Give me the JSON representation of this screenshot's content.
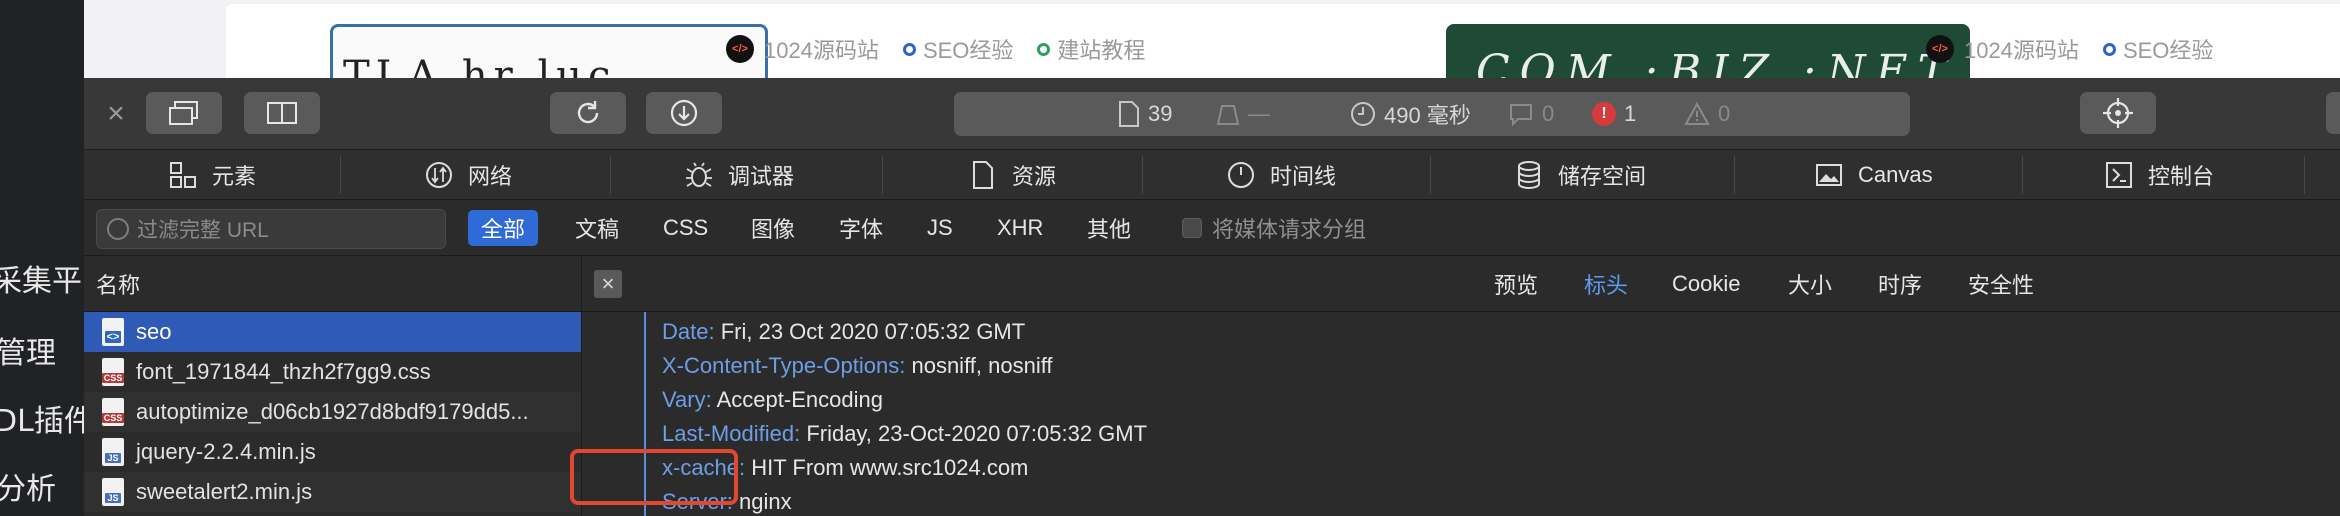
{
  "sidebar": {
    "items": [
      "采集平台",
      "管理",
      "DL插件",
      "分析"
    ]
  },
  "webpage": {
    "cards": [
      {
        "site_name": "1024源码站",
        "logo_text": "</>",
        "tags": [
          "SEO经验",
          "建站教程"
        ]
      },
      {
        "site_name": "1024源码站",
        "logo_text": "</>",
        "tags": [
          "SEO经验"
        ]
      }
    ]
  },
  "toolbar": {
    "close_label": "×",
    "summary": {
      "resources": "39",
      "transferred": "—",
      "load_time": "490 毫秒",
      "logs": "0",
      "errors": "1",
      "warnings": "0"
    }
  },
  "tabs": [
    {
      "label": "元素",
      "icon": "elements-icon"
    },
    {
      "label": "网络",
      "icon": "network-icon"
    },
    {
      "label": "调试器",
      "icon": "debugger-icon"
    },
    {
      "label": "资源",
      "icon": "resources-icon"
    },
    {
      "label": "时间线",
      "icon": "timeline-icon"
    },
    {
      "label": "储存空间",
      "icon": "storage-icon"
    },
    {
      "label": "Canvas",
      "icon": "canvas-icon"
    },
    {
      "label": "控制台",
      "icon": "console-icon"
    }
  ],
  "filter": {
    "placeholder": "过滤完整 URL",
    "types": [
      "全部",
      "文稿",
      "CSS",
      "图像",
      "字体",
      "JS",
      "XHR",
      "其他"
    ],
    "active_type": "全部",
    "group_media_label": "将媒体请求分组"
  },
  "filelist": {
    "header": "名称",
    "files": [
      {
        "name": "seo",
        "type": "doc",
        "badge": "<>"
      },
      {
        "name": "font_1971844_thzh2f7gg9.css",
        "type": "css",
        "badge": "CSS"
      },
      {
        "name": "autoptimize_d06cb1927d8bdf9179dd5...",
        "type": "css",
        "badge": "CSS"
      },
      {
        "name": "jquery-2.2.4.min.js",
        "type": "js",
        "badge": "JS"
      },
      {
        "name": "sweetalert2.min.js",
        "type": "js",
        "badge": "JS"
      }
    ]
  },
  "detail": {
    "close_label": "×",
    "tabs": [
      "预览",
      "标头",
      "Cookie",
      "大小",
      "时序",
      "安全性"
    ],
    "active_tab": "标头",
    "headers": [
      {
        "key": "Date:",
        "value": "Fri, 23 Oct 2020 07:05:32 GMT"
      },
      {
        "key": "X-Content-Type-Options:",
        "value": "nosniff, nosniff"
      },
      {
        "key": "Vary:",
        "value": "Accept-Encoding"
      },
      {
        "key": "Last-Modified:",
        "value": "Friday, 23-Oct-2020 07:05:32 GMT"
      },
      {
        "key": "x-cache:",
        "value": "HIT From www.src1024.com"
      },
      {
        "key": "Server:",
        "value": "nginx"
      }
    ]
  },
  "colors": {
    "accent": "#2e6bd6",
    "highlight_box": "#e0492f",
    "header_key": "#6d9ee6",
    "error": "#d63a3a"
  }
}
